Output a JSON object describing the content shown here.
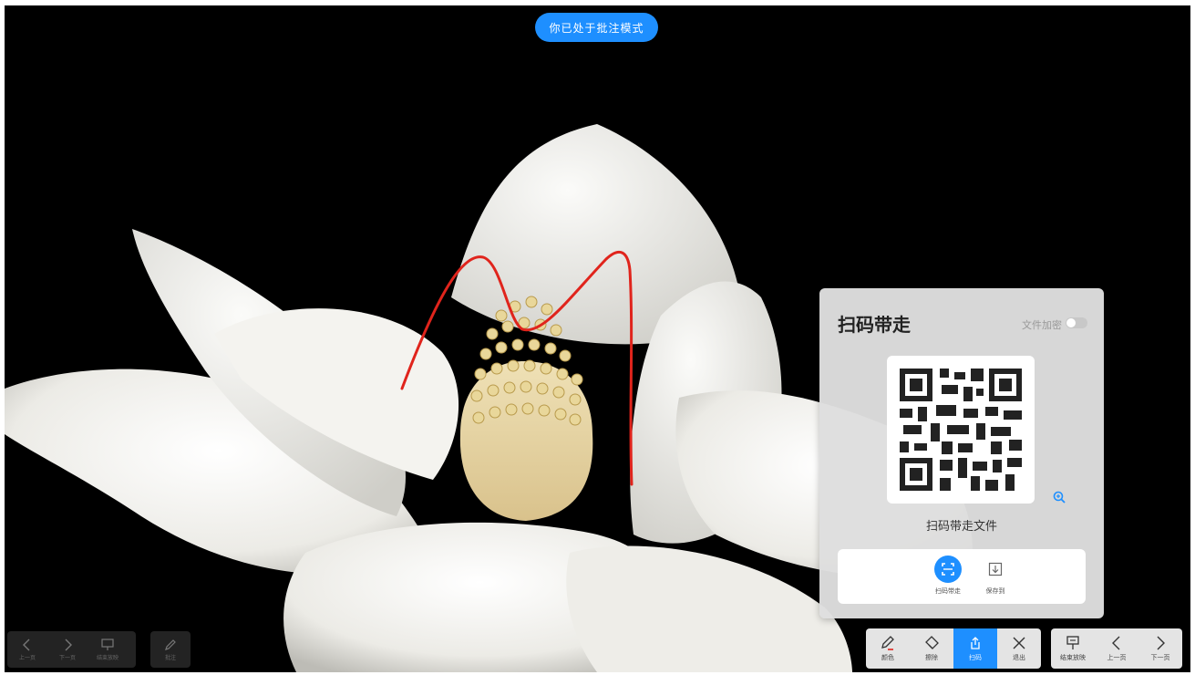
{
  "banner": {
    "text": "你已处于批注模式"
  },
  "qr_panel": {
    "title": "扫码带走",
    "encrypt_label": "文件加密",
    "caption": "扫码带走文件",
    "actions": [
      {
        "label": "扫码带走",
        "icon": "scan-icon"
      },
      {
        "label": "保存到",
        "icon": "download-icon"
      }
    ]
  },
  "annotation_toolbar": [
    {
      "label": "颜色",
      "icon": "pen-icon"
    },
    {
      "label": "擦除",
      "icon": "eraser-icon"
    },
    {
      "label": "扫码",
      "icon": "share-icon"
    },
    {
      "label": "退出",
      "icon": "close-icon"
    }
  ],
  "nav_toolbar": [
    {
      "label": "结束放映",
      "icon": "presentation-icon"
    },
    {
      "label": "上一页",
      "icon": "chevron-left-icon"
    },
    {
      "label": "下一页",
      "icon": "chevron-right-icon"
    }
  ],
  "left_toolbar": [
    {
      "label": "上一页",
      "icon": "chevron-left-icon"
    },
    {
      "label": "下一页",
      "icon": "chevron-right-icon"
    },
    {
      "label": "结束放映",
      "icon": "presentation-icon"
    }
  ],
  "left_pen": {
    "label": "批注",
    "icon": "pen-icon"
  },
  "colors": {
    "accent": "#1e8fff",
    "annotation_stroke": "#e0241c",
    "background": "#000000"
  }
}
